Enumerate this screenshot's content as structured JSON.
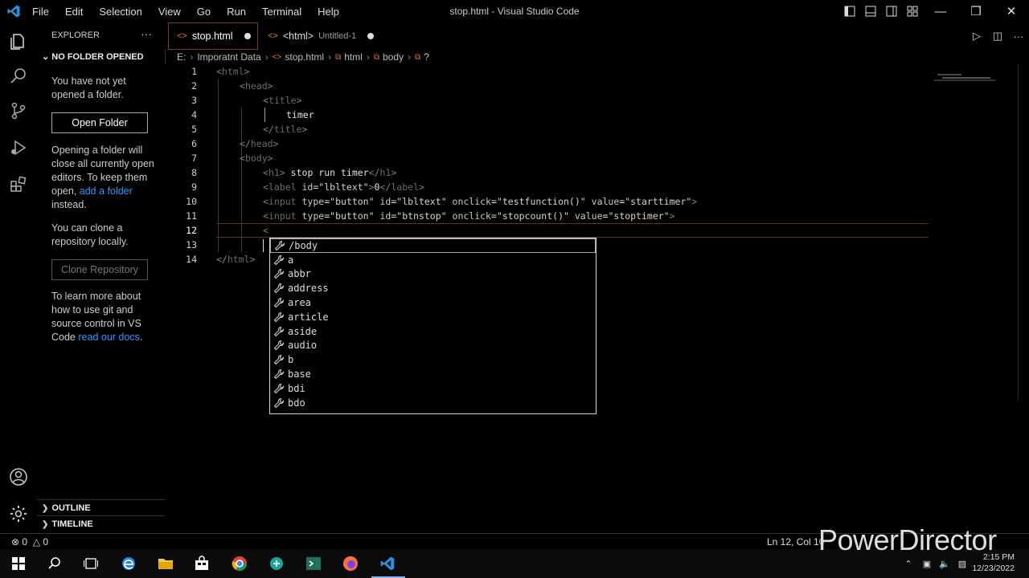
{
  "window": {
    "title": "stop.html - Visual Studio Code",
    "menu": [
      "File",
      "Edit",
      "Selection",
      "View",
      "Go",
      "Run",
      "Terminal",
      "Help"
    ]
  },
  "sidebar": {
    "header": "EXPLORER",
    "more": "···",
    "section": "NO FOLDER OPENED",
    "text1": "You have not yet opened a folder.",
    "open_folder": "Open Folder",
    "text2_a": "Opening a folder will close all currently open editors. To keep them open,",
    "text2_link": "add a folder",
    "text2_b": "instead.",
    "text3": "You can clone a repository locally.",
    "clone_repo": "Clone Repository",
    "text4_a": "To learn more about how to use git and source control in VS Code",
    "text4_link": "read our docs",
    "text4_b": ".",
    "outline": "OUTLINE",
    "timeline": "TIMELINE"
  },
  "tabs": [
    {
      "label": "stop.html",
      "dirty": true,
      "active": true
    },
    {
      "label": "<html>",
      "suffix": "Untitled-1",
      "dirty": true,
      "active": false
    }
  ],
  "breadcrumb": [
    "E:",
    "Imporatnt Data",
    "stop.html",
    "html",
    "body",
    "?"
  ],
  "editor": {
    "lines": [
      {
        "n": "1"
      },
      {
        "n": "2"
      },
      {
        "n": "3"
      },
      {
        "n": "4"
      },
      {
        "n": "5"
      },
      {
        "n": "6"
      },
      {
        "n": "7"
      },
      {
        "n": "8"
      },
      {
        "n": "9"
      },
      {
        "n": "10"
      },
      {
        "n": "11"
      },
      {
        "n": "12"
      },
      {
        "n": "13"
      },
      {
        "n": "14"
      }
    ],
    "code": {
      "l4": "timer",
      "l8": "stop run timer",
      "l9_id": "\"lbltext\"",
      "l9_text": "0",
      "l10_type": "\"button\"",
      "l10_id": "\"lbltext\"",
      "l10_onclick": "\"testfunction()\"",
      "l10_value": "\"starttimer\"",
      "l11_type": "\"button\"",
      "l11_id": "\"btnstop\"",
      "l11_onclick": "\"stopcount()\"",
      "l11_value": "\"stoptimer\"",
      "l12": "<"
    }
  },
  "suggestions": [
    "/body",
    "a",
    "abbr",
    "address",
    "area",
    "article",
    "aside",
    "audio",
    "b",
    "base",
    "bdi",
    "bdo"
  ],
  "status": {
    "errors": "0",
    "warnings": "0",
    "position": "Ln 12, Col 10"
  },
  "watermark": "PowerDirector",
  "clock": {
    "time": "2:15 PM",
    "date": "12/23/2022"
  }
}
